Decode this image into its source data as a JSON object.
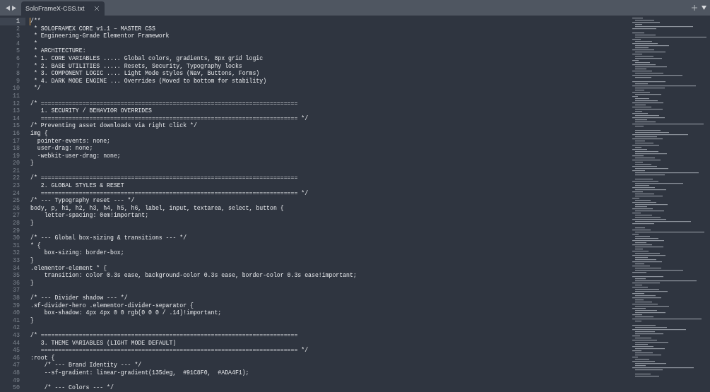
{
  "tabs": [
    {
      "title": "SoloFrameX-CSS.txt",
      "selected": true
    }
  ],
  "lines": [
    {
      "number": "1",
      "text": "/**",
      "current": true
    },
    {
      "number": "2",
      "text": " * SOLOFRAMEX CORE v1.1 – MASTER CSS",
      "current": false
    },
    {
      "number": "3",
      "text": " * Engineering-Grade Elementor Framework",
      "current": false
    },
    {
      "number": "4",
      "text": " *",
      "current": false
    },
    {
      "number": "5",
      "text": " * ARCHITECTURE:",
      "current": false
    },
    {
      "number": "6",
      "text": " * 1. CORE VARIABLES ..... Global colors, gradients, 8px grid logic",
      "current": false
    },
    {
      "number": "7",
      "text": " * 2. BASE UTILITIES ..... Resets, Security, Typography locks",
      "current": false
    },
    {
      "number": "8",
      "text": " * 3. COMPONENT LOGIC .... Light Mode styles (Nav, Buttons, Forms)",
      "current": false
    },
    {
      "number": "9",
      "text": " * 4. DARK MODE ENGINE ... Overrides (Moved to bottom for stability)",
      "current": false
    },
    {
      "number": "10",
      "text": " */",
      "current": false
    },
    {
      "number": "11",
      "current": false
    },
    {
      "number": "12",
      "text": "/* ==========================================================================",
      "current": false
    },
    {
      "number": "13",
      "text": "   1. SECURITY / BEHAVIOR OVERRIDES",
      "current": false
    },
    {
      "number": "14",
      "text": "   ========================================================================== */",
      "current": false
    },
    {
      "number": "15",
      "text": "/* Preventing asset downloads via right click */",
      "current": false
    },
    {
      "number": "16",
      "text": "img {",
      "current": false
    },
    {
      "number": "17",
      "text": "  pointer-events: none;",
      "current": false
    },
    {
      "number": "18",
      "text": "  user-drag: none;",
      "current": false
    },
    {
      "number": "19",
      "text": "  -webkit-user-drag: none;",
      "current": false
    },
    {
      "number": "20",
      "text": "}",
      "current": false
    },
    {
      "number": "21",
      "current": false
    },
    {
      "number": "22",
      "text": "/* ==========================================================================",
      "current": false
    },
    {
      "number": "23",
      "text": "   2. GLOBAL STYLES & RESET",
      "current": false
    },
    {
      "number": "24",
      "text": "   ========================================================================== */",
      "current": false
    },
    {
      "number": "25",
      "text": "/* --- Typography reset --- */",
      "current": false
    },
    {
      "number": "26",
      "text": "body, p, h1, h2, h3, h4, h5, h6, label, input, textarea, select, button {",
      "current": false
    },
    {
      "number": "27",
      "text": "    letter-spacing: 0em!important;",
      "current": false
    },
    {
      "number": "28",
      "text": "}",
      "current": false
    },
    {
      "number": "29",
      "current": false
    },
    {
      "number": "30",
      "text": "/* --- Global box-sizing & transitions --- */",
      "current": false
    },
    {
      "number": "31",
      "text": "* {",
      "current": false
    },
    {
      "number": "32",
      "text": "    box-sizing: border-box;",
      "current": false
    },
    {
      "number": "33",
      "text": "}",
      "current": false
    },
    {
      "number": "34",
      "text": ".elementor-element * {",
      "current": false
    },
    {
      "number": "35",
      "text": "    transition: color 0.3s ease, background-color 0.3s ease, border-color 0.3s ease!important;",
      "current": false
    },
    {
      "number": "36",
      "text": "}",
      "current": false
    },
    {
      "number": "37",
      "current": false
    },
    {
      "number": "38",
      "text": "/* --- Divider shadow --- */",
      "current": false
    },
    {
      "number": "39",
      "text": ".sf-divider-hero .elementor-divider-separator {",
      "current": false
    },
    {
      "number": "40",
      "text": "    box-shadow: 4px 4px 0 0 rgb(0 0 0 / .14)!important;",
      "current": false
    },
    {
      "number": "41",
      "text": "}",
      "current": false
    },
    {
      "number": "42",
      "current": false
    },
    {
      "number": "43",
      "text": "/* ==========================================================================",
      "current": false
    },
    {
      "number": "44",
      "text": "   3. THEME VARIABLES (LIGHT MODE DEFAULT)",
      "current": false
    },
    {
      "number": "45",
      "text": "   ========================================================================== */",
      "current": false
    },
    {
      "number": "46",
      "text": ":root {",
      "current": false
    },
    {
      "number": "47",
      "text": "    /* --- Brand Identity --- */",
      "current": false
    },
    {
      "number": "48",
      "text": "    --sf-gradient: linear-gradient(135deg,  #91C8F0,  #ADA4F1);",
      "current": false
    },
    {
      "number": "49",
      "current": false
    },
    {
      "number": "50",
      "text": "    /* --- Colors --- */",
      "current": false
    }
  ]
}
